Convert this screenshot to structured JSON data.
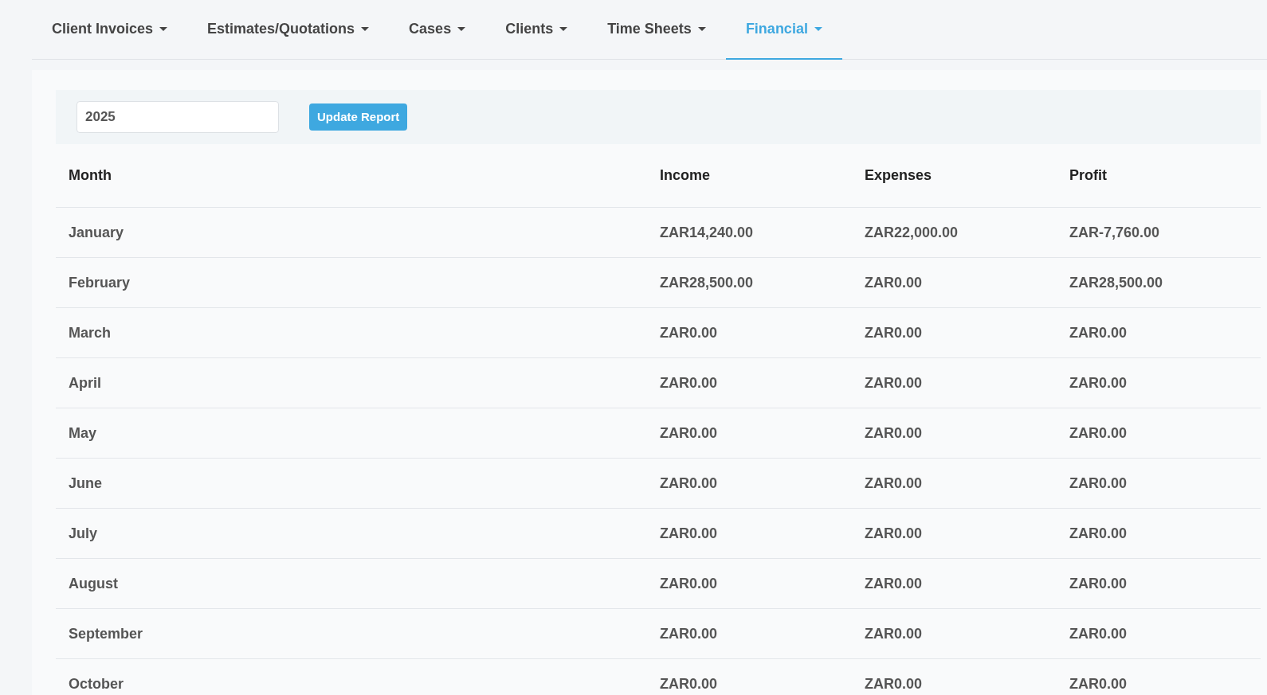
{
  "tabs": [
    {
      "label": "Client Invoices",
      "selected": false
    },
    {
      "label": "Estimates/Quotations",
      "selected": false
    },
    {
      "label": "Cases",
      "selected": false
    },
    {
      "label": "Clients",
      "selected": false
    },
    {
      "label": "Time Sheets",
      "selected": false
    },
    {
      "label": "Financial",
      "selected": true
    }
  ],
  "filter": {
    "year": "2025",
    "button": "Update Report"
  },
  "table": {
    "columns": [
      "Month",
      "Income",
      "Expenses",
      "Profit"
    ],
    "rows": [
      [
        "January",
        "ZAR14,240.00",
        "ZAR22,000.00",
        "ZAR-7,760.00"
      ],
      [
        "February",
        "ZAR28,500.00",
        "ZAR0.00",
        "ZAR28,500.00"
      ],
      [
        "March",
        "ZAR0.00",
        "ZAR0.00",
        "ZAR0.00"
      ],
      [
        "April",
        "ZAR0.00",
        "ZAR0.00",
        "ZAR0.00"
      ],
      [
        "May",
        "ZAR0.00",
        "ZAR0.00",
        "ZAR0.00"
      ],
      [
        "June",
        "ZAR0.00",
        "ZAR0.00",
        "ZAR0.00"
      ],
      [
        "July",
        "ZAR0.00",
        "ZAR0.00",
        "ZAR0.00"
      ],
      [
        "August",
        "ZAR0.00",
        "ZAR0.00",
        "ZAR0.00"
      ],
      [
        "September",
        "ZAR0.00",
        "ZAR0.00",
        "ZAR0.00"
      ],
      [
        "October",
        "ZAR0.00",
        "ZAR0.00",
        "ZAR0.00"
      ]
    ]
  }
}
